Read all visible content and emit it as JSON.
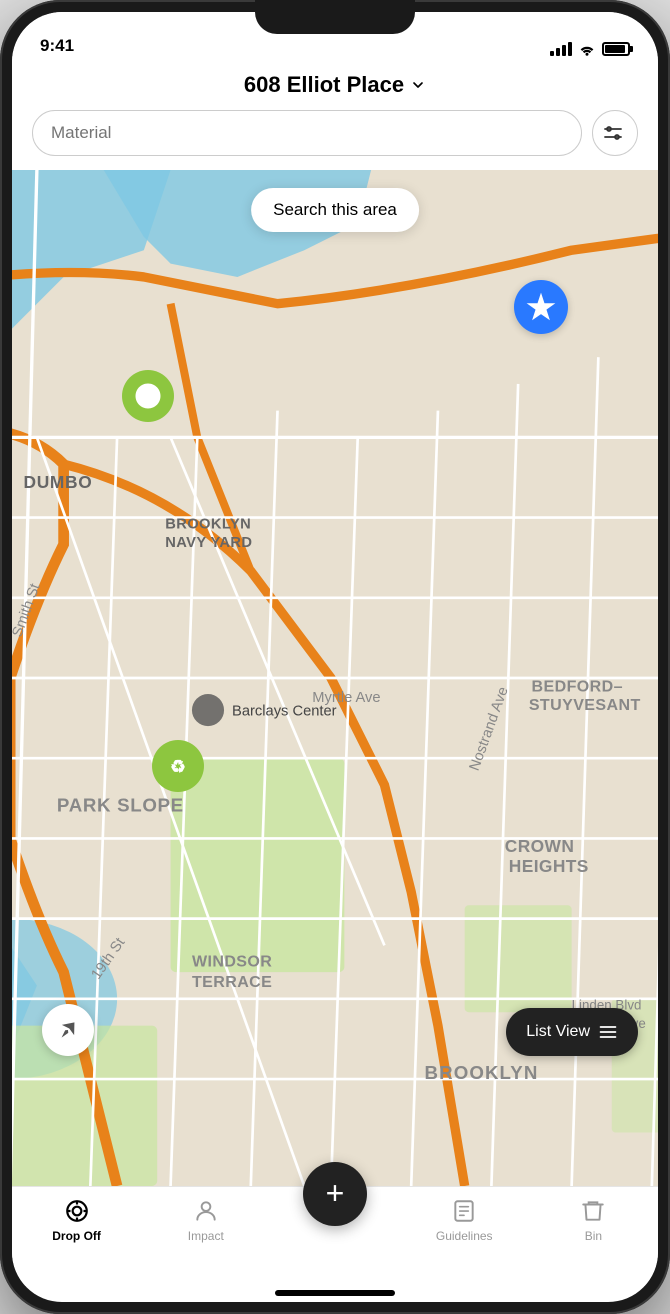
{
  "status_bar": {
    "time": "9:41"
  },
  "header": {
    "location_name": "608 Elliot Place",
    "chevron": "chevron-down",
    "search_placeholder": "Material"
  },
  "map": {
    "search_area_btn": "Search this area",
    "list_view_btn": "List View",
    "markers": [
      {
        "type": "recycle",
        "id": "marker-1"
      },
      {
        "type": "recycle",
        "id": "marker-2"
      },
      {
        "type": "star",
        "id": "marker-3"
      }
    ]
  },
  "tab_bar": {
    "tabs": [
      {
        "id": "drop-off",
        "label": "Drop Off",
        "active": true
      },
      {
        "id": "impact",
        "label": "Impact",
        "active": false
      },
      {
        "id": "plus",
        "label": "",
        "active": false
      },
      {
        "id": "guidelines",
        "label": "Guidelines",
        "active": false
      },
      {
        "id": "bin",
        "label": "Bin",
        "active": false
      }
    ]
  },
  "fab": {
    "label": "+"
  }
}
